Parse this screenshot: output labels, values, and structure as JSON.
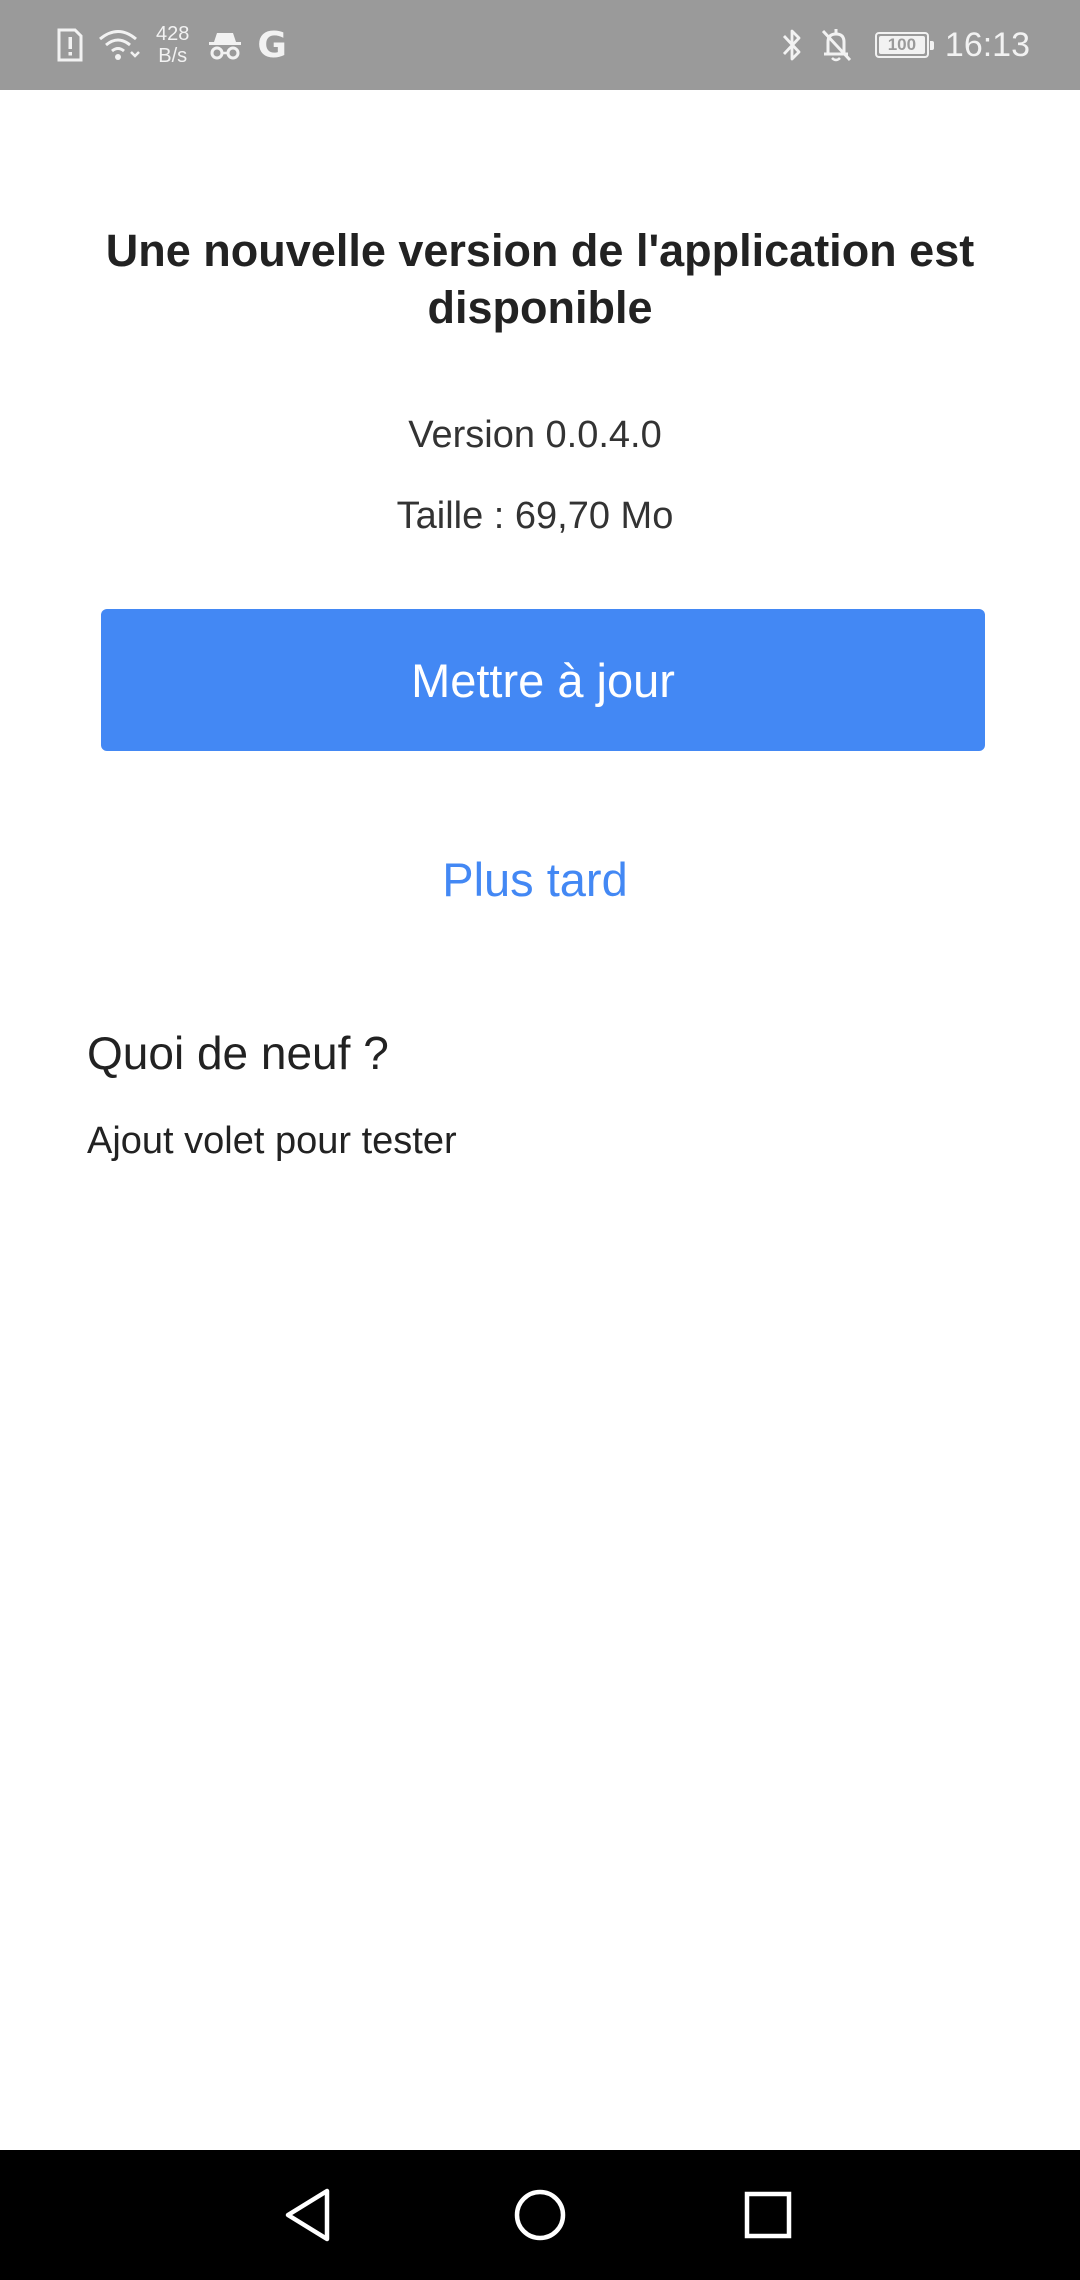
{
  "status_bar": {
    "net_speed_value": "428",
    "net_speed_unit": "B/s",
    "google_letter": "G",
    "battery_level": "100",
    "time": "16:13",
    "icons": [
      "alert-icon",
      "wifi-icon",
      "incognito-icon",
      "google-icon",
      "bluetooth-icon",
      "notifications-off-icon",
      "battery-icon"
    ]
  },
  "dialog": {
    "title": "Une nouvelle version de l'application est disponible",
    "version_text": "Version 0.0.4.0",
    "size_text": "Taille : 69,70 Mo",
    "update_button_label": "Mettre à jour",
    "later_link_label": "Plus tard",
    "whats_new_heading": "Quoi de neuf ?",
    "whats_new_body": "Ajout volet pour tester"
  },
  "nav_bar": {
    "icons": [
      "back-icon",
      "home-icon",
      "recent-apps-icon"
    ]
  },
  "colors": {
    "accent": "#4388f4",
    "status_bar": "#9a9a9a",
    "nav_bar": "#000000",
    "text": "#222222"
  }
}
